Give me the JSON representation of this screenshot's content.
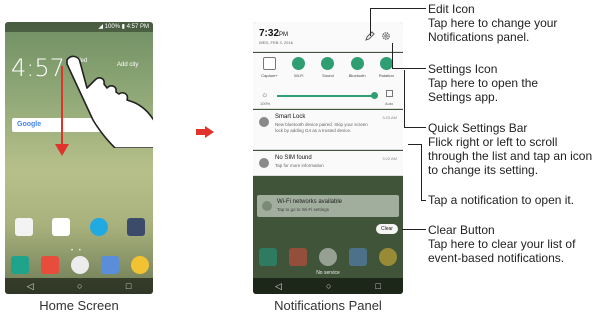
{
  "home": {
    "status": "◢ 100% ▮ 4:57 PM",
    "clock": "4:57",
    "date": "Wed",
    "add_city": "Add city",
    "search": "Google",
    "dots": "• •",
    "caption": "Home Screen"
  },
  "notif": {
    "time": "7:32",
    "ampm": "PM",
    "date": "WED, FEB 3, 2016",
    "quick_settings": [
      {
        "label": "Capture+",
        "icon": "capture-plus-icon"
      },
      {
        "label": "Wi-Fi",
        "icon": "wifi-icon"
      },
      {
        "label": "Sound",
        "icon": "sound-icon"
      },
      {
        "label": "Bluetooth",
        "icon": "bluetooth-icon"
      },
      {
        "label": "Rotation",
        "icon": "rotation-icon"
      }
    ],
    "brightness_pct": "100%",
    "brightness_auto": "Auto",
    "notifications": [
      {
        "title": "Smart Lock",
        "body": "New bluetooth device paired. Skip your screen lock by adding G4 as a trusted device.",
        "time": "3:23 AM"
      },
      {
        "title": "No SIM found",
        "body": "Tap for more information",
        "time": "3:22 AM"
      }
    ],
    "wifi_title": "Wi-Fi networks available",
    "wifi_body": "Tap to go to Wi-Fi settings",
    "clear": "Clear",
    "no_service": "No service",
    "caption": "Notifications Panel"
  },
  "callouts": {
    "edit_title": "Edit Icon",
    "edit_body": "Tap here to change your Notifications panel.",
    "settings_title": "Settings Icon",
    "settings_body_pre": "Tap here to open the",
    "settings_body_app": "Settings",
    "settings_body_post": "app.",
    "qs_title": "Quick Settings Bar",
    "qs_body": "Flick right or left to scroll through the list and tap an icon to change its setting.",
    "tap_notification": "Tap a notification to open it.",
    "clear_title": "Clear Button",
    "clear_body": "Tap here to clear your list of event-based notifications."
  },
  "colors": {
    "accent_green": "#2f9e72",
    "arrow_red": "#e0332c"
  }
}
